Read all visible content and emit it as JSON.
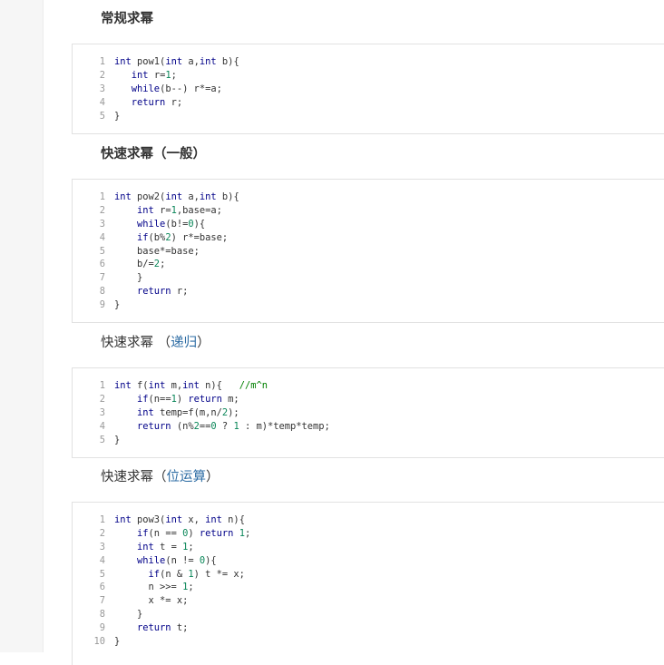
{
  "sections": [
    {
      "title_main": "常规求幂",
      "title_link": "",
      "title_close": "",
      "lines": [
        [
          [
            "int",
            "kw"
          ],
          [
            " pow1(",
            ""
          ],
          [
            "int",
            "kw"
          ],
          [
            " a,",
            ""
          ],
          [
            "int",
            "kw"
          ],
          [
            " b){",
            ""
          ]
        ],
        [
          [
            "   ",
            ""
          ],
          [
            "int",
            "kw"
          ],
          [
            " r=",
            ""
          ],
          [
            "1",
            "num"
          ],
          [
            ";",
            ""
          ]
        ],
        [
          [
            "   ",
            ""
          ],
          [
            "while",
            "kw"
          ],
          [
            "(b--) r*=a;",
            ""
          ]
        ],
        [
          [
            "   ",
            ""
          ],
          [
            "return",
            "kw"
          ],
          [
            " r;",
            ""
          ]
        ],
        [
          [
            "}",
            ""
          ]
        ]
      ]
    },
    {
      "title_main": "快速求幂（一般）",
      "title_link": "",
      "title_close": "",
      "lines": [
        [
          [
            "int",
            "kw"
          ],
          [
            " pow2(",
            ""
          ],
          [
            "int",
            "kw"
          ],
          [
            " a,",
            ""
          ],
          [
            "int",
            "kw"
          ],
          [
            " b){",
            ""
          ]
        ],
        [
          [
            "    ",
            ""
          ],
          [
            "int",
            "kw"
          ],
          [
            " r=",
            ""
          ],
          [
            "1",
            "num"
          ],
          [
            ",base=a;",
            ""
          ]
        ],
        [
          [
            "    ",
            ""
          ],
          [
            "while",
            "kw"
          ],
          [
            "(b!=",
            ""
          ],
          [
            "0",
            "num"
          ],
          [
            "){",
            ""
          ]
        ],
        [
          [
            "    ",
            ""
          ],
          [
            "if",
            "kw"
          ],
          [
            "(b%",
            ""
          ],
          [
            "2",
            "num"
          ],
          [
            ") r*=base;",
            ""
          ]
        ],
        [
          [
            "    base*=base;",
            ""
          ]
        ],
        [
          [
            "    b/=",
            ""
          ],
          [
            "2",
            "num"
          ],
          [
            ";",
            ""
          ]
        ],
        [
          [
            "    }",
            ""
          ]
        ],
        [
          [
            "    ",
            ""
          ],
          [
            "return",
            "kw"
          ],
          [
            " r;",
            ""
          ]
        ],
        [
          [
            "}",
            ""
          ]
        ]
      ]
    },
    {
      "title_main": "快速求幂 （",
      "title_link": "递归",
      "title_close": "）",
      "lines": [
        [
          [
            "int",
            "kw"
          ],
          [
            " f(",
            ""
          ],
          [
            "int",
            "kw"
          ],
          [
            " m,",
            ""
          ],
          [
            "int",
            "kw"
          ],
          [
            " n){   ",
            ""
          ],
          [
            "//m^n",
            "cm"
          ]
        ],
        [
          [
            "    ",
            ""
          ],
          [
            "if",
            "kw"
          ],
          [
            "(n==",
            ""
          ],
          [
            "1",
            "num"
          ],
          [
            ") ",
            ""
          ],
          [
            "return",
            "kw"
          ],
          [
            " m;",
            ""
          ]
        ],
        [
          [
            "    ",
            ""
          ],
          [
            "int",
            "kw"
          ],
          [
            " temp=f(m,n/",
            ""
          ],
          [
            "2",
            "num"
          ],
          [
            ");",
            ""
          ]
        ],
        [
          [
            "    ",
            ""
          ],
          [
            "return",
            "kw"
          ],
          [
            " (n%",
            ""
          ],
          [
            "2",
            "num"
          ],
          [
            "==",
            ""
          ],
          [
            "0",
            "num"
          ],
          [
            " ? ",
            ""
          ],
          [
            "1",
            "num"
          ],
          [
            " : m)*temp*temp;",
            ""
          ]
        ],
        [
          [
            "}",
            ""
          ]
        ]
      ]
    },
    {
      "title_main": "快速求幂（",
      "title_link": "位运算",
      "title_close": "）",
      "lines": [
        [
          [
            "int",
            "kw"
          ],
          [
            " pow3(",
            ""
          ],
          [
            "int",
            "kw"
          ],
          [
            " x, ",
            ""
          ],
          [
            "int",
            "kw"
          ],
          [
            " n){",
            ""
          ]
        ],
        [
          [
            "    ",
            ""
          ],
          [
            "if",
            "kw"
          ],
          [
            "(n == ",
            ""
          ],
          [
            "0",
            "num"
          ],
          [
            ") ",
            ""
          ],
          [
            "return",
            "kw"
          ],
          [
            " ",
            ""
          ],
          [
            "1",
            "num"
          ],
          [
            ";",
            ""
          ]
        ],
        [
          [
            "    ",
            ""
          ],
          [
            "int",
            "kw"
          ],
          [
            " t = ",
            ""
          ],
          [
            "1",
            "num"
          ],
          [
            ";",
            ""
          ]
        ],
        [
          [
            "    ",
            ""
          ],
          [
            "while",
            "kw"
          ],
          [
            "(n != ",
            ""
          ],
          [
            "0",
            "num"
          ],
          [
            "){",
            ""
          ]
        ],
        [
          [
            "      ",
            ""
          ],
          [
            "if",
            "kw"
          ],
          [
            "(n & ",
            ""
          ],
          [
            "1",
            "num"
          ],
          [
            ") t *= x;",
            ""
          ]
        ],
        [
          [
            "      n >>= ",
            ""
          ],
          [
            "1",
            "num"
          ],
          [
            ";",
            ""
          ]
        ],
        [
          [
            "      x *= x;",
            ""
          ]
        ],
        [
          [
            "    }",
            ""
          ]
        ],
        [
          [
            "    ",
            ""
          ],
          [
            "return",
            "kw"
          ],
          [
            " t;",
            ""
          ]
        ],
        [
          [
            "}",
            ""
          ]
        ]
      ]
    }
  ]
}
